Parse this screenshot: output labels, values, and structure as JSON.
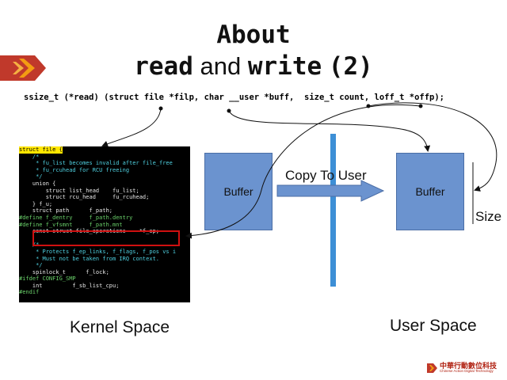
{
  "title": {
    "line1": "About",
    "read": "read",
    "and": "and",
    "write": "write",
    "suffix": "(2)"
  },
  "signature": "ssize_t (*read) (struct file *filp, char __user *buff,  size_t count, loff_t *offp);",
  "code_lines": [
    {
      "text": "struct file {",
      "style": "hl"
    },
    {
      "text": "\t/*",
      "style": "comment"
    },
    {
      "text": "\t * fu_list becomes invalid after file_free",
      "style": "comment"
    },
    {
      "text": "\t * fu_rcuhead for RCU freeing",
      "style": "comment"
    },
    {
      "text": "\t */",
      "style": "comment"
    },
    {
      "text": "\tunion {",
      "style": "plain"
    },
    {
      "text": "\t\tstruct list_head    fu_list;",
      "style": "plain"
    },
    {
      "text": "\t\tstruct rcu_head     fu_rcuhead;",
      "style": "plain"
    },
    {
      "text": "\t} f_u;",
      "style": "plain"
    },
    {
      "text": "\tstruct path      f_path;",
      "style": "plain"
    },
    {
      "text": "#define f_dentry     f_path.dentry",
      "style": "pre"
    },
    {
      "text": "#define f_vfsmnt     f_path.mnt",
      "style": "pre"
    },
    {
      "text": "\tconst struct file_operations    *f_op;",
      "style": "plain"
    },
    {
      "text": "",
      "style": "plain"
    },
    {
      "text": "\t/*",
      "style": "comment"
    },
    {
      "text": "\t * Protects f_ep_links, f_flags, f_pos vs i",
      "style": "comment"
    },
    {
      "text": "\t * Must not be taken from IRQ context.",
      "style": "comment"
    },
    {
      "text": "\t */",
      "style": "comment"
    },
    {
      "text": "\tspinlock_t      f_lock;",
      "style": "plain"
    },
    {
      "text": "#ifdef CONFIG_SMP",
      "style": "pre"
    },
    {
      "text": "\tint         f_sb_list_cpu;",
      "style": "plain"
    },
    {
      "text": "#endif",
      "style": "pre"
    }
  ],
  "buffers": {
    "kernel": "Buffer",
    "user": "Buffer"
  },
  "copy_label": "Copy To User",
  "size_label": "Size",
  "kernel_space_label": "Kernel Space",
  "user_space_label": "User Space",
  "logo": {
    "chinese": "中華行動數位科技",
    "english": "Chinese Action Digital Technology"
  },
  "colors": {
    "buffer_fill": "#6b93cf",
    "divider": "#3d8fd6",
    "highlight_box": "#d01010",
    "brand": "#b02010",
    "code_bg": "#000000"
  }
}
